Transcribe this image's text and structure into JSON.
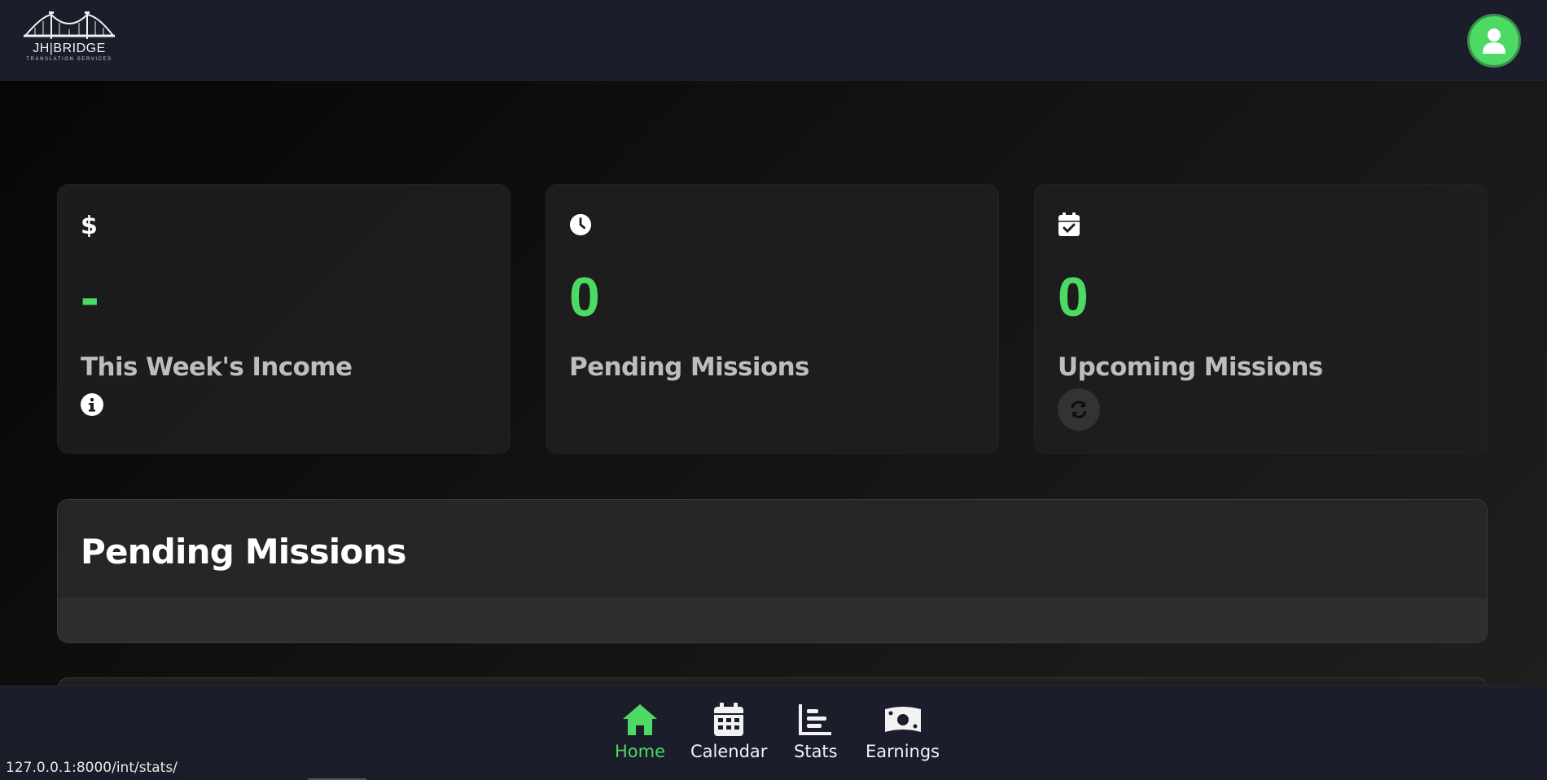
{
  "header": {
    "logo_name": "JH|BRIDGE",
    "logo_sub": "TRANSLATION SERVICES"
  },
  "cards": [
    {
      "icon": "dollar-icon",
      "value": "-",
      "label": "This Week's Income",
      "extra_icon": "info-icon"
    },
    {
      "icon": "clock-icon",
      "value": "0",
      "label": "Pending Missions"
    },
    {
      "icon": "calendar-check-icon",
      "value": "0",
      "label": "Upcoming Missions",
      "extra_icon": "refresh-icon"
    }
  ],
  "pending_panel": {
    "title": "Pending Missions"
  },
  "nav": [
    {
      "label": "Home",
      "icon": "home-icon",
      "active": true
    },
    {
      "label": "Calendar",
      "icon": "calendar-icon",
      "active": false
    },
    {
      "label": "Stats",
      "icon": "bar-chart-icon",
      "active": false
    },
    {
      "label": "Earnings",
      "icon": "money-bill-icon",
      "active": false
    }
  ],
  "status_url": "127.0.0.1:8000/int/stats/",
  "colors": {
    "accent": "#4cd964",
    "nav_bg": "#1b1d2a",
    "card_bg": "#1e1e1e"
  }
}
